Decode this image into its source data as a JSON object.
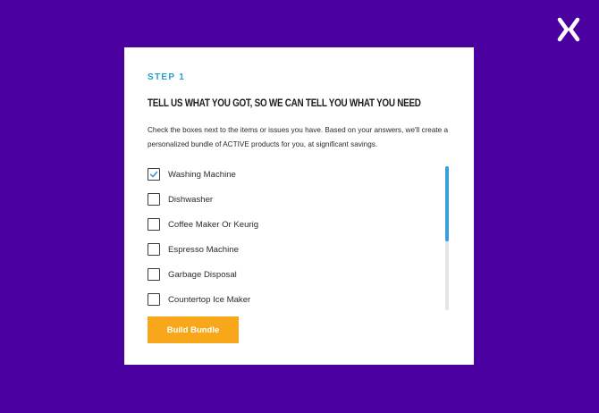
{
  "close": {
    "icon": "close-icon"
  },
  "modal": {
    "step_label": "STEP 1",
    "heading": "TELL US WHAT YOU GOT, SO WE CAN TELL YOU WHAT YOU NEED",
    "description": "Check the boxes next to the items or issues you have. Based on your answers, we'll create a personalized bundle of ACTIVE products for you, at significant savings.",
    "items": [
      {
        "label": "Washing Machine",
        "checked": true
      },
      {
        "label": "Dishwasher",
        "checked": false
      },
      {
        "label": "Coffee Maker Or Keurig",
        "checked": false
      },
      {
        "label": "Espresso Machine",
        "checked": false
      },
      {
        "label": "Garbage Disposal",
        "checked": false
      },
      {
        "label": "Countertop Ice Maker",
        "checked": false
      }
    ],
    "button_label": "Build Bundle",
    "colors": {
      "background": "#4b01a0",
      "accent": "#23a0cf",
      "button": "#f8a71b",
      "scroll_thumb": "#3a9fd8"
    }
  }
}
